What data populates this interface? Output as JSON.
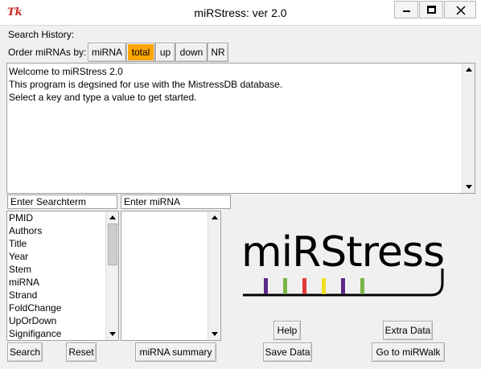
{
  "window": {
    "title": "miRStress: ver 2.0",
    "icon_text": "Tk",
    "controls": [
      "minimize",
      "maximize",
      "close"
    ]
  },
  "search_history_label": "Search History:",
  "order": {
    "label": "Order miRNAs by:",
    "buttons": [
      "miRNA",
      "total",
      "up",
      "down",
      "NR"
    ],
    "active": "total",
    "active_color": "#ffa500"
  },
  "output_text": [
    "Welcome to miRStress 2.0",
    "This program is degsined for use with the MistressDB database.",
    "Select a key and type a value to get started."
  ],
  "search_input": {
    "value": "Enter Searchterm"
  },
  "mirna_input": {
    "value": "Enter miRNA"
  },
  "key_list": [
    "PMID",
    "Authors",
    "Title",
    "Year",
    "Stem",
    "miRNA",
    "Strand",
    "FoldChange",
    "UpOrDown",
    "Signifigance"
  ],
  "logo": {
    "text": "miRStress",
    "bar_colors": [
      "#5b2a86",
      "#7ab648",
      "#e23a3a",
      "#f0e020",
      "#5b2a86",
      "#7ab648"
    ]
  },
  "buttons": {
    "search": "Search",
    "reset": "Reset",
    "mirna_summary": "miRNA summary",
    "help": "Help",
    "save_data": "Save Data",
    "extra_data": "Extra Data",
    "go_mirwalk": "Go to miRWalk"
  }
}
